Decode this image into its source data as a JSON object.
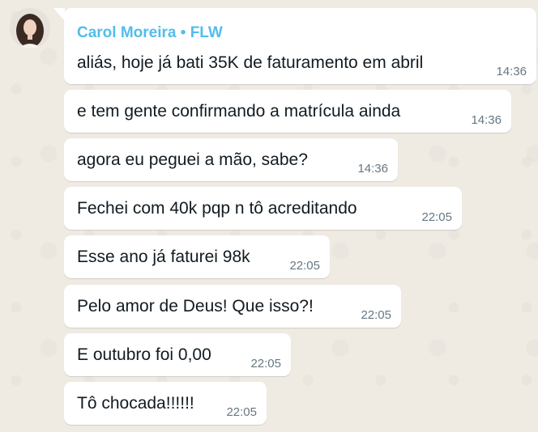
{
  "chat": {
    "sender": "Carol Moreira • FLW",
    "messages": [
      {
        "text": "aliás, hoje já bati 35K de faturamento em abril",
        "time": "14:36"
      },
      {
        "text": "e tem gente confirmando a matrícula ainda",
        "time": "14:36"
      },
      {
        "text": "agora eu peguei a mão, sabe?",
        "time": "14:36"
      },
      {
        "text": "Fechei com 40k pqp n tô acreditando",
        "time": "22:05"
      },
      {
        "text": "Esse ano já faturei 98k",
        "time": "22:05"
      },
      {
        "text": "Pelo amor de Deus! Que isso?!",
        "time": "22:05"
      },
      {
        "text": "E outubro foi 0,00",
        "time": "22:05"
      },
      {
        "text": "Tô chocada!!!!!!",
        "time": "22:05"
      }
    ]
  },
  "colors": {
    "background": "#efeae2",
    "bubble": "#ffffff",
    "sender_name": "#53bdeb",
    "timestamp": "#667781",
    "text": "#111b21"
  },
  "icons": {
    "avatar": "contact-avatar"
  }
}
